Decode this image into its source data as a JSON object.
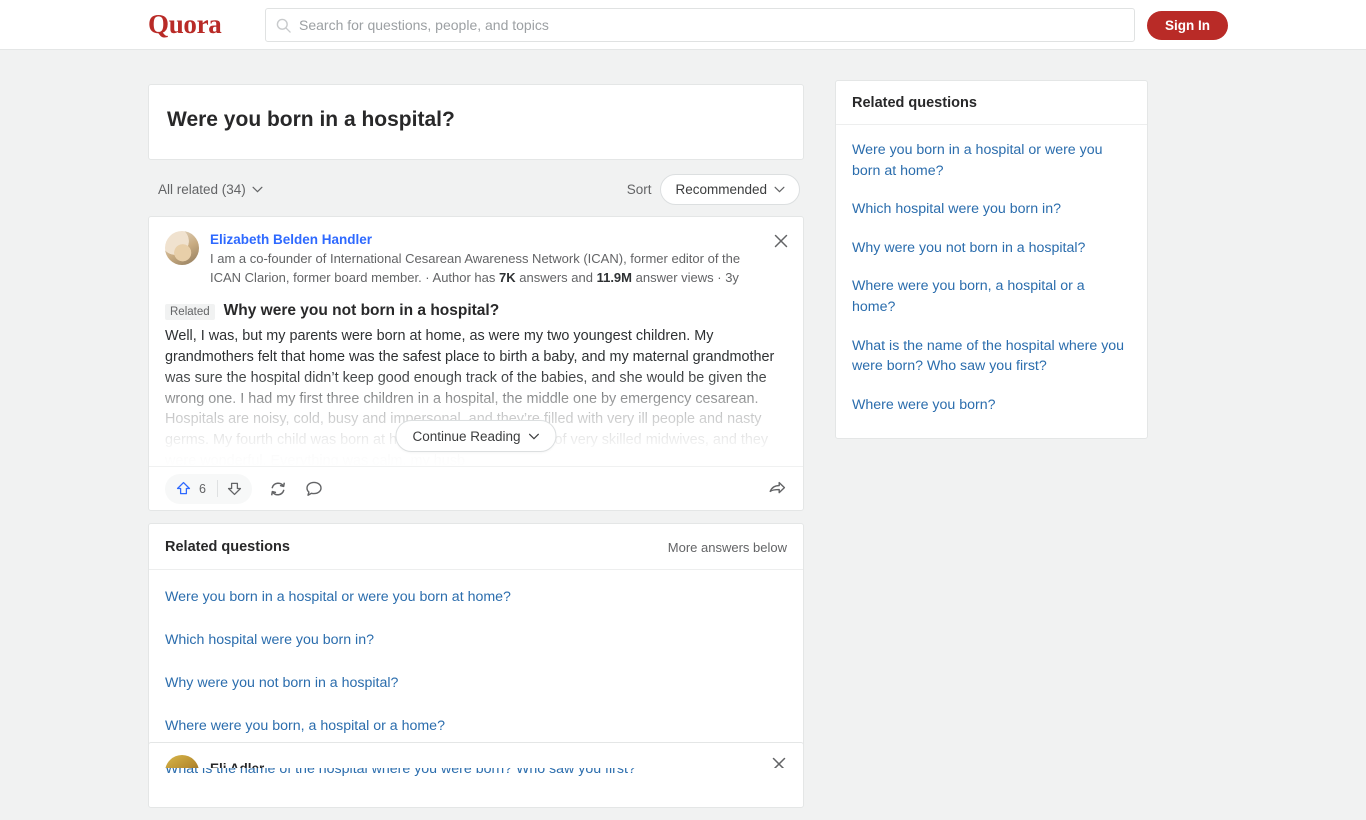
{
  "header": {
    "logo": "Quora",
    "search_placeholder": "Search for questions, people, and topics",
    "signin_label": "Sign In",
    "brand_color": "#b92b27"
  },
  "question": {
    "title": "Were you born in a hospital?"
  },
  "filters": {
    "all_related_label": "All related (34)",
    "sort_label": "Sort",
    "sort_value": "Recommended"
  },
  "answer": {
    "author": "Elizabeth Belden Handler",
    "credential_prefix": "I am a co-founder of International Cesarean Awareness Network (ICAN), former editor of the ICAN Clarion, former board member. · Author has ",
    "credential_answers": "7K",
    "credential_mid": " answers and ",
    "credential_views": "11.9M",
    "credential_suffix": " answer views · 3y",
    "related_badge": "Related",
    "related_question": "Why were you not born in a hospital?",
    "body": "Well, I was, but my parents were born at home, as were my two youngest children. My grandmothers felt that home was the safest place to birth a baby, and my maternal grandmother was sure the hospital didn’t keep good enough track of the babies, and she would be given the wrong one. I had my first three children in a hospital, the middle one by emergency cesarean. Hospitals are noisy, cold, busy and impersonal, and they’re filled with very ill people and nasty germs. My fourth child was born at home with the assistance of very skilled midwives, and they were wonderful. Everything was calm, my husb",
    "continue_label": "Continue Reading",
    "upvote_count": "6",
    "upvote_color": "#2e69ff"
  },
  "related_questions_card": {
    "title": "Related questions",
    "more_label": "More answers below",
    "items": [
      "Were you born in a hospital or were you born at home?",
      "Which hospital were you born in?",
      "Why were you not born in a hospital?",
      "Where were you born, a hospital or a home?",
      "What is the name of the hospital where you were born? Who saw you first?"
    ]
  },
  "sidebar": {
    "title": "Related questions",
    "items": [
      "Were you born in a hospital or were you born at home?",
      "Which hospital were you born in?",
      "Why were you not born in a hospital?",
      "Where were you born, a hospital or a home?",
      "What is the name of the hospital where you were born? Who saw you first?",
      "Where were you born?"
    ]
  },
  "next_answer": {
    "author": "Eli Adler"
  }
}
